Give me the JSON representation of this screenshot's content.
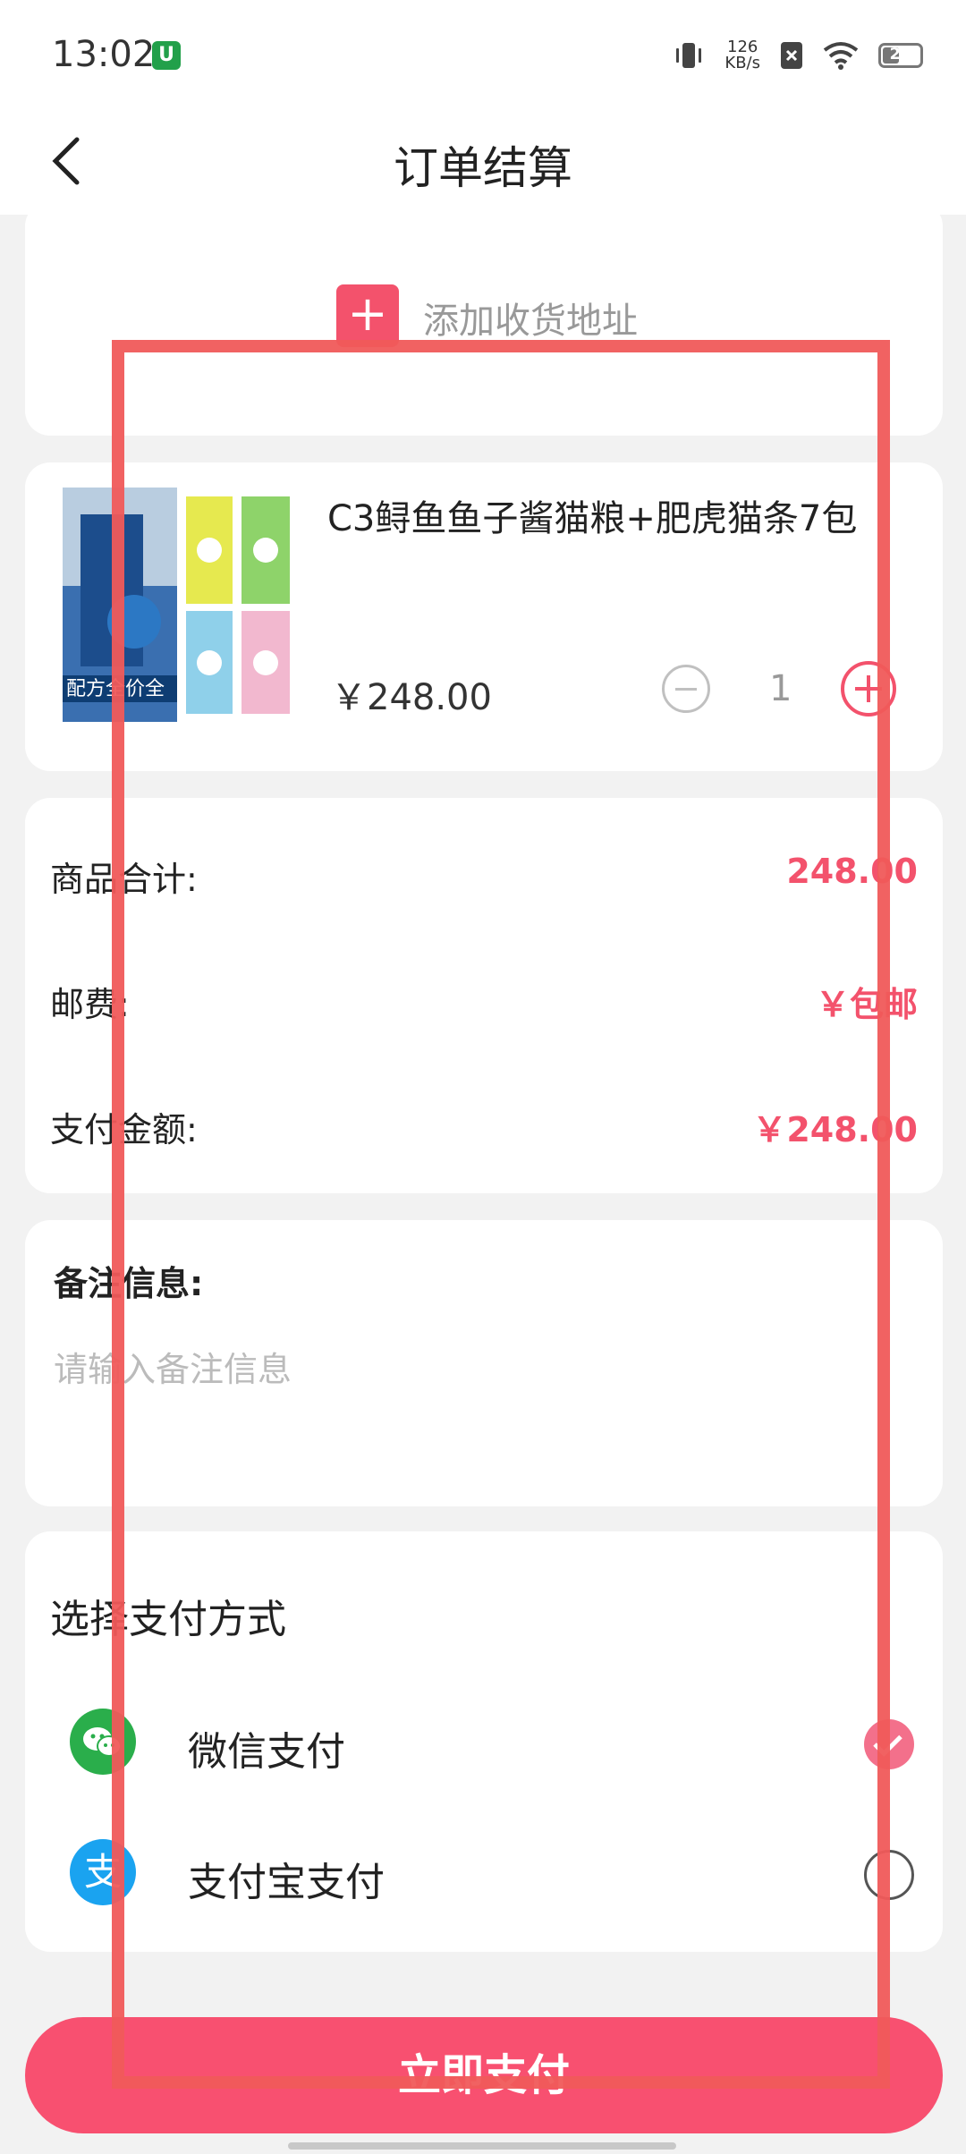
{
  "status_bar": {
    "time": "13:02",
    "badge": "U",
    "net_speed_value": "126",
    "net_speed_unit": "KB/s",
    "battery": "23"
  },
  "nav": {
    "title": "订单结算",
    "back_icon": "chevron-left-icon"
  },
  "address": {
    "add_label": "添加收货地址",
    "plus_symbol": "+"
  },
  "product": {
    "name": "C3鲟鱼鱼子酱猫粮+肥虎猫条7包",
    "price": "￥248.00",
    "quantity": "1",
    "thumb_text": "配方全价全"
  },
  "summary": {
    "subtotal_label": "商品合计:",
    "subtotal_value": "248.00",
    "shipping_label": "邮费:",
    "shipping_value": "￥包邮",
    "total_label": "支付金额:",
    "total_value": "￥248.00"
  },
  "remark": {
    "title": "备注信息:",
    "placeholder": "请输入备注信息"
  },
  "payment": {
    "title": "选择支付方式",
    "options": [
      {
        "name": "微信支付",
        "selected": true,
        "color": "#2aae4b",
        "icon": "wechat-icon"
      },
      {
        "name": "支付宝支付",
        "selected": false,
        "color": "#1aa3f0",
        "icon": "alipay-icon",
        "glyph": "支"
      }
    ]
  },
  "pay_button": {
    "label": "立即支付"
  },
  "colors": {
    "accent": "#f3526c",
    "overlay_box": "#f05a5a"
  }
}
